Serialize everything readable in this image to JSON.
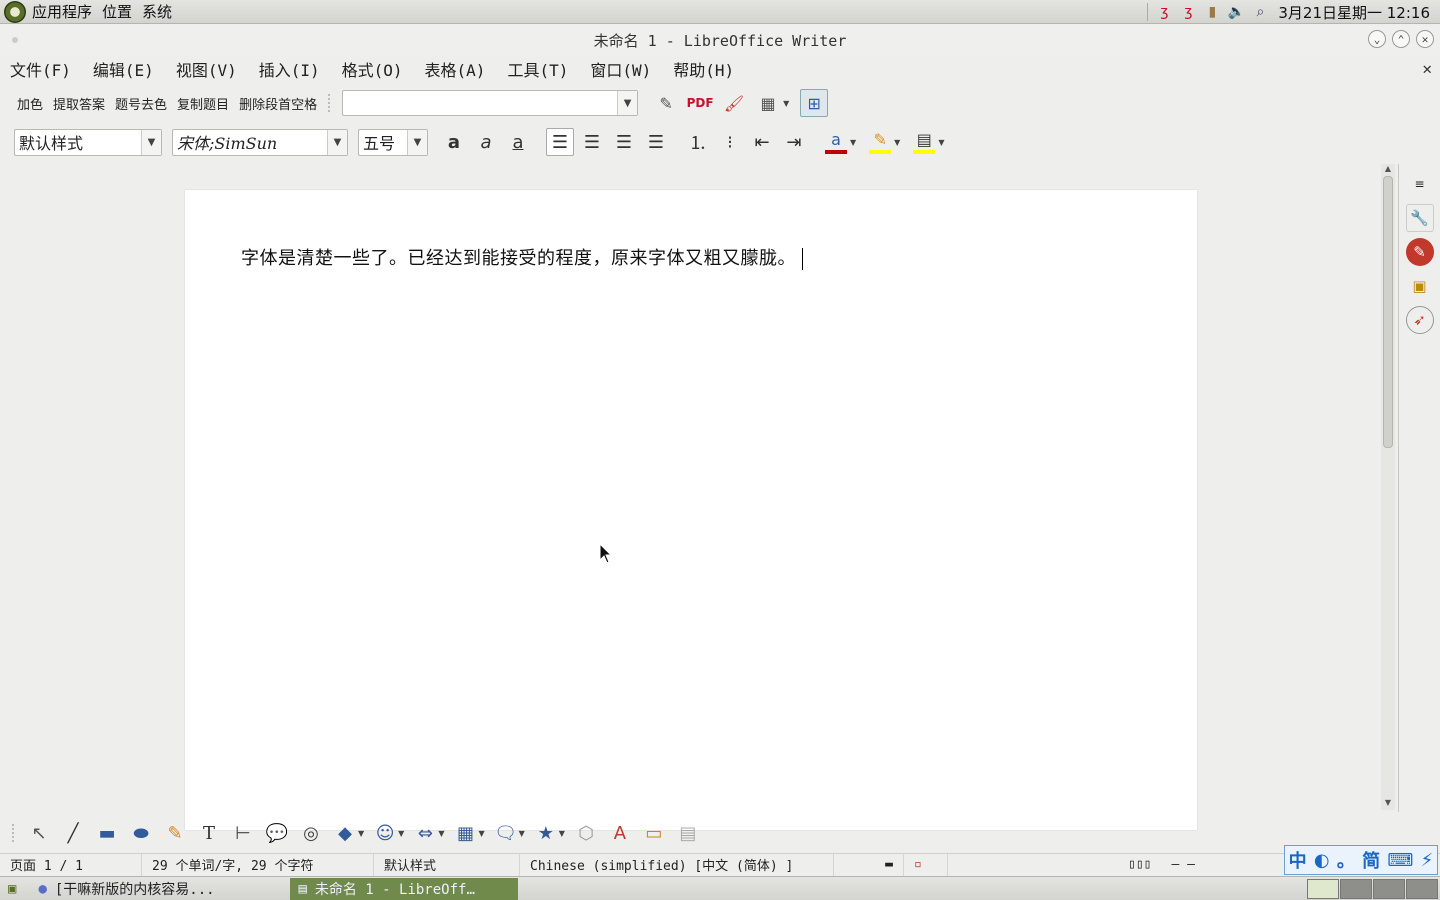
{
  "top_panel": {
    "menus": [
      "应用程序",
      "位置",
      "系统"
    ],
    "clock": "3月21日星期一  12:16"
  },
  "window": {
    "title": "未命名 1 - LibreOffice Writer"
  },
  "menubar": {
    "items": [
      "文件(F)",
      "编辑(E)",
      "视图(V)",
      "插入(I)",
      "格式(O)",
      "表格(A)",
      "工具(T)",
      "窗口(W)",
      "帮助(H)"
    ]
  },
  "toolbar1": {
    "macros": [
      "加色",
      "提取答案",
      "题号去色",
      "复制题目",
      "删除段首空格"
    ],
    "combo_value": ""
  },
  "toolbar2": {
    "paragraph_style": "默认样式",
    "font_name": "宋体;SimSun",
    "font_size": "五号"
  },
  "colors": {
    "font_color": "#c00000",
    "highlight_color": "#ffff00",
    "background_color": "#ffff00",
    "task_active": "#6f8a4a",
    "ime_blue": "#1a66c6"
  },
  "document": {
    "text": "字体是清楚一些了。已经达到能接受的程度，原来字体又粗又朦胧。"
  },
  "statusbar": {
    "page": "页面 1 / 1",
    "words": "29 个单词/字, 29 个字符",
    "style": "默认样式",
    "language": "Chinese (simplified) [中文 (简体) ]"
  },
  "ime": {
    "mode": "中",
    "punct": "。",
    "script": "简"
  },
  "taskbar": {
    "task1": "[干嘛新版的内核容易...",
    "task2": "未命名 1 - LibreOff…"
  }
}
